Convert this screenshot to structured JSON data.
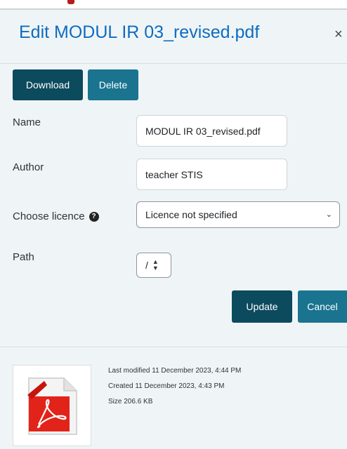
{
  "dialog": {
    "title": "Edit MODUL IR 03_revised.pdf",
    "close_glyph": "×"
  },
  "actions": {
    "download_label": "Download",
    "delete_label": "Delete"
  },
  "form": {
    "name_label": "Name",
    "name_value": "MODUL IR 03_revised.pdf",
    "author_label": "Author",
    "author_value": "teacher STIS",
    "licence_label": "Choose licence",
    "licence_value": "Licence not specified",
    "path_label": "Path",
    "path_value": "/"
  },
  "buttons": {
    "update_label": "Update",
    "cancel_label": "Cancel"
  },
  "file_info": {
    "last_modified": "Last modified  11 December 2023, 4:44 PM",
    "created": "Created  11 December 2023, 4:43 PM",
    "size": "Size  206.6 KB"
  },
  "icons": {
    "file_icon": "pdf-file-icon",
    "help_icon": "question-circle-icon"
  },
  "colors": {
    "title": "#0f6cbf",
    "primary_button": "#0c4a5e",
    "secondary_button": "#1a7490",
    "modal_background": "#eff5f7"
  }
}
